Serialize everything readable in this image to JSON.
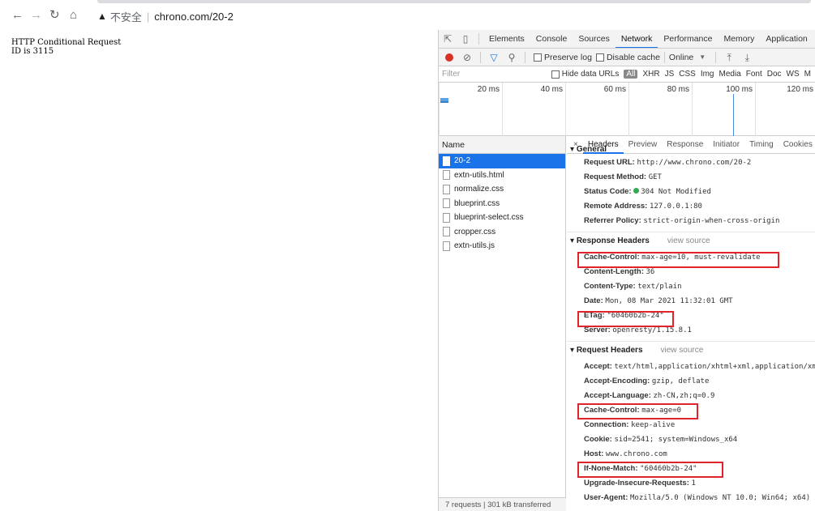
{
  "browser": {
    "back_icon": "arrow-left-icon",
    "forward_icon": "arrow-right-icon",
    "reload_icon": "reload-icon",
    "home_icon": "home-icon",
    "security_label": "不安全",
    "url": "chrono.com/20-2"
  },
  "page": {
    "line1": "HTTP Conditional Request",
    "line2": "ID is 3115"
  },
  "devtools": {
    "tabs": [
      "Elements",
      "Console",
      "Sources",
      "Network",
      "Performance",
      "Memory",
      "Application"
    ],
    "active_tab": "Network",
    "toolbar": {
      "preserve_log": "Preserve log",
      "disable_cache": "Disable cache",
      "throttle": "Online"
    },
    "filter": {
      "placeholder": "Filter",
      "hide_data_urls": "Hide data URLs",
      "all": "All",
      "types": [
        "XHR",
        "JS",
        "CSS",
        "Img",
        "Media",
        "Font",
        "Doc",
        "WS",
        "M"
      ]
    },
    "timeline_ticks": [
      "20 ms",
      "40 ms",
      "60 ms",
      "80 ms",
      "100 ms",
      "120 ms"
    ],
    "name_header": "Name",
    "files": [
      "20-2",
      "extn-utils.html",
      "normalize.css",
      "blueprint.css",
      "blueprint-select.css",
      "cropper.css",
      "extn-utils.js"
    ],
    "footer": "7 requests | 301 kB transferred",
    "detail_tabs": [
      "Headers",
      "Preview",
      "Response",
      "Initiator",
      "Timing",
      "Cookies"
    ],
    "general": {
      "title": "General",
      "rows": [
        {
          "k": "Request URL:",
          "v": "http://www.chrono.com/20-2"
        },
        {
          "k": "Request Method:",
          "v": "GET"
        },
        {
          "k": "Status Code:",
          "v": "304 Not Modified"
        },
        {
          "k": "Remote Address:",
          "v": "127.0.0.1:80"
        },
        {
          "k": "Referrer Policy:",
          "v": "strict-origin-when-cross-origin"
        }
      ]
    },
    "response_headers": {
      "title": "Response Headers",
      "view_source": "view source",
      "rows": [
        {
          "k": "Cache-Control:",
          "v": "max-age=10, must-revalidate"
        },
        {
          "k": "Content-Length:",
          "v": "36"
        },
        {
          "k": "Content-Type:",
          "v": "text/plain"
        },
        {
          "k": "Date:",
          "v": "Mon, 08 Mar 2021 11:32:01 GMT"
        },
        {
          "k": "ETag:",
          "v": "\"60460b2b-24\""
        },
        {
          "k": "Server:",
          "v": "openresty/1.15.8.1"
        }
      ]
    },
    "request_headers": {
      "title": "Request Headers",
      "view_source": "view source",
      "rows": [
        {
          "k": "Accept:",
          "v": "text/html,application/xhtml+xml,application/xm"
        },
        {
          "k": "Accept-Encoding:",
          "v": "gzip, deflate"
        },
        {
          "k": "Accept-Language:",
          "v": "zh-CN,zh;q=0.9"
        },
        {
          "k": "Cache-Control:",
          "v": "max-age=0"
        },
        {
          "k": "Connection:",
          "v": "keep-alive"
        },
        {
          "k": "Cookie:",
          "v": "sid=2541; system=Windows_x64"
        },
        {
          "k": "Host:",
          "v": "www.chrono.com"
        },
        {
          "k": "If-None-Match:",
          "v": "\"60460b2b-24\""
        },
        {
          "k": "Upgrade-Insecure-Requests:",
          "v": "1"
        },
        {
          "k": "User-Agent:",
          "v": "Mozilla/5.0 (Windows NT 10.0; Win64; x64) A"
        }
      ]
    },
    "colors": {
      "accent": "#1a73e8",
      "record": "#d93025",
      "status_ok": "#34a853",
      "highlight": "#e0242b"
    }
  }
}
